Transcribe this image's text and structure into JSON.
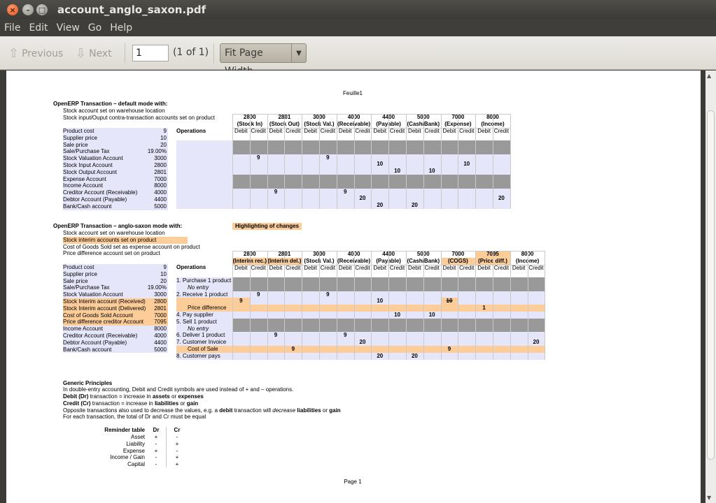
{
  "window": {
    "title": "account_anglo_saxon.pdf"
  },
  "menu": [
    "File",
    "Edit",
    "View",
    "Go",
    "Help"
  ],
  "toolbar": {
    "previous_label": "Previous",
    "next_label": "Next",
    "page_value": "1",
    "page_count": "(1 of 1)",
    "zoom_label": "Fit Page Width"
  },
  "doc": {
    "header": "Feuille1",
    "footer": "Page 1",
    "section1": {
      "title": "OpenERP Transaction – default mode with:",
      "notes": [
        "Stock account set on warehouse location",
        "Stock input/Ouput contra-transaction accounts set on product"
      ],
      "params": [
        [
          "Product cost",
          "9"
        ],
        [
          "Supplier price",
          "10"
        ],
        [
          "Sale price",
          "20"
        ],
        [
          "Sale/Purchase Tax",
          "19.00%"
        ],
        [
          "Stock Valuation Account",
          "3000"
        ],
        [
          "Stock Input Account",
          "2800"
        ],
        [
          "Stock Output Account",
          "2801"
        ],
        [
          "Expense Account",
          "7000"
        ],
        [
          "Income Account",
          "8000"
        ],
        [
          "Creditor Account (Receivable)",
          "4000"
        ],
        [
          "Debtor Account (Payable)",
          "4400"
        ],
        [
          "Bank/Cash account",
          "5000"
        ]
      ],
      "accounts": [
        [
          "2800",
          "(Stock In)"
        ],
        [
          "2801",
          "(Stock Out)"
        ],
        [
          "3000",
          "(Stock Val.)"
        ],
        [
          "4000",
          "(Receivable)"
        ],
        [
          "4400",
          "(Payable)"
        ],
        [
          "5000",
          "(Cash/Bank)"
        ],
        [
          "7000",
          "(Expense)"
        ],
        [
          "8000",
          "(Income)"
        ]
      ],
      "ops_header": "Operations",
      "ops": [
        "1. Purchase 1 product",
        "No entry",
        "2. Receive 1 product",
        "3. Supplier invoice",
        "4. Pay supplier",
        "5. Sell 1 product",
        "No entry",
        "6. Deliver 1 product",
        "7. Customer Invoice",
        "8. Customer pays"
      ]
    },
    "section2": {
      "title": "OpenERP Transaction – anglo-saxon mode with:",
      "highlight_label": "Highlighting of changes",
      "notes": [
        "Stock account set on warehouse location",
        "Stock interim accounts set on product",
        "Cost of Goods Sold set as expense account on product",
        "Price difference account set on product"
      ],
      "params": [
        [
          "Product cost",
          "9"
        ],
        [
          "Supplier price",
          "10"
        ],
        [
          "Sale price",
          "20"
        ],
        [
          "Sale/Purchase Tax",
          "19.00%"
        ],
        [
          "Stock Valuation Account",
          "3000"
        ],
        [
          "Stock Interim account (Received)",
          "2800"
        ],
        [
          "Stock Interim account (Delivered)",
          "2801"
        ],
        [
          "Cost of Goods Sold Account",
          "7000"
        ],
        [
          "Price difference creditor Account",
          "7095"
        ],
        [
          "Income Account",
          "8000"
        ],
        [
          "Creditor Account (Receivable)",
          "4000"
        ],
        [
          "Debtor Account (Payable)",
          "4400"
        ],
        [
          "Bank/Cash account",
          "5000"
        ]
      ],
      "accounts": [
        [
          "2800",
          "(Interim rec.)"
        ],
        [
          "2801",
          "(Interim del.)"
        ],
        [
          "3000",
          "(Stock Val.)"
        ],
        [
          "4000",
          "(Receivable)"
        ],
        [
          "4400",
          "(Payable)"
        ],
        [
          "5000",
          "(Cash/Bank)"
        ],
        [
          "7000",
          "(COGS)"
        ],
        [
          "7095",
          "(Price diff.)"
        ],
        [
          "8000",
          "(Income)"
        ]
      ],
      "ops_header": "Operations",
      "ops": [
        "1. Purchase 1 product",
        "No entry",
        "2. Receive 1 product",
        "3. Supplier invoice",
        "Price difference",
        "4. Pay supplier",
        "5. Sell 1 product",
        "No entry",
        "6. Deliver 1 product",
        "7. Customer Invoice",
        "Cost of Sale",
        "8. Customer pays"
      ]
    },
    "debit": "Debit",
    "credit": "Credit",
    "principles": {
      "title": "Generic Principles",
      "line1": "In double-entry accounting, Debit and Credit symbols are used instead of + and – operations.",
      "dr_bold": "Debit (Dr)",
      "dr_rest": " transaction = increase in ",
      "dr_b2": "assets",
      "dr_or": " or ",
      "dr_b3": "expenses",
      "cr_bold": "Credit (Cr)",
      "cr_rest": " transaction = increase in ",
      "cr_b2": "liabilities",
      "cr_or": " or ",
      "cr_b3": "gain",
      "opp_a": "Opposite transactions also used to decrease the values, e.g. a ",
      "opp_b": "debit",
      "opp_c": " transaction will ",
      "opp_d": "decrease",
      "opp_e": " liabilities",
      "opp_f": " or ",
      "opp_g": "gain",
      "line5": "For each transaction, the total of Dr and Cr must be equal"
    },
    "reminder": {
      "title": "Reminder table",
      "dr": "Dr",
      "cr": "Cr",
      "rows": [
        [
          "Asset",
          "+",
          "-"
        ],
        [
          "Liability",
          "-",
          "+"
        ],
        [
          "Expense",
          "+",
          "-"
        ],
        [
          "Income / Gain",
          "-",
          "+"
        ],
        [
          "Capital",
          "-",
          "+"
        ]
      ]
    },
    "values1": {
      "r2c1": "9",
      "r2c5": "9",
      "r3c8": "10",
      "r3c13": "10",
      "r4c9": "10",
      "r4c11": "10",
      "r7c2": "9",
      "r7c6": "9",
      "r8c7": "20",
      "r8c15": "20",
      "r9c8": "20",
      "r9c10": "20"
    },
    "values2": {
      "r2c1": "9",
      "r2c5": "9",
      "r3c0": "9",
      "r3c8": "10",
      "r3c12": "10",
      "r4c14": "1",
      "r5c9": "10",
      "r5c11": "10",
      "r8c2": "9",
      "r8c6": "9",
      "r9c7": "20",
      "r9c17": "20",
      "r10c3": "9",
      "r10c12": "9",
      "r11c8": "20",
      "r11c10": "20"
    }
  }
}
